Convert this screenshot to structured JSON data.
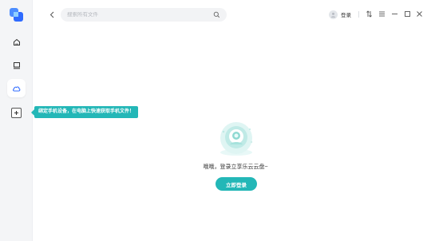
{
  "sidebar": {
    "items": [
      {
        "name": "home",
        "icon": "home-icon"
      },
      {
        "name": "computer",
        "icon": "monitor-icon"
      },
      {
        "name": "cloud",
        "icon": "cloud-icon",
        "active": true
      }
    ],
    "add_icon": "plus-icon",
    "tooltip": "绑定手机设备，在电脑上快速获取手机文件！"
  },
  "header": {
    "search_placeholder": "搜索所有文件",
    "login_label": "登录"
  },
  "empty_state": {
    "message": "哦哦，登录立享乐云云盘~",
    "button_label": "立即登录"
  },
  "colors": {
    "accent": "#23b7b7",
    "sidebar_bg": "#f4f5f7",
    "logo_blue": "#2f6bff"
  }
}
